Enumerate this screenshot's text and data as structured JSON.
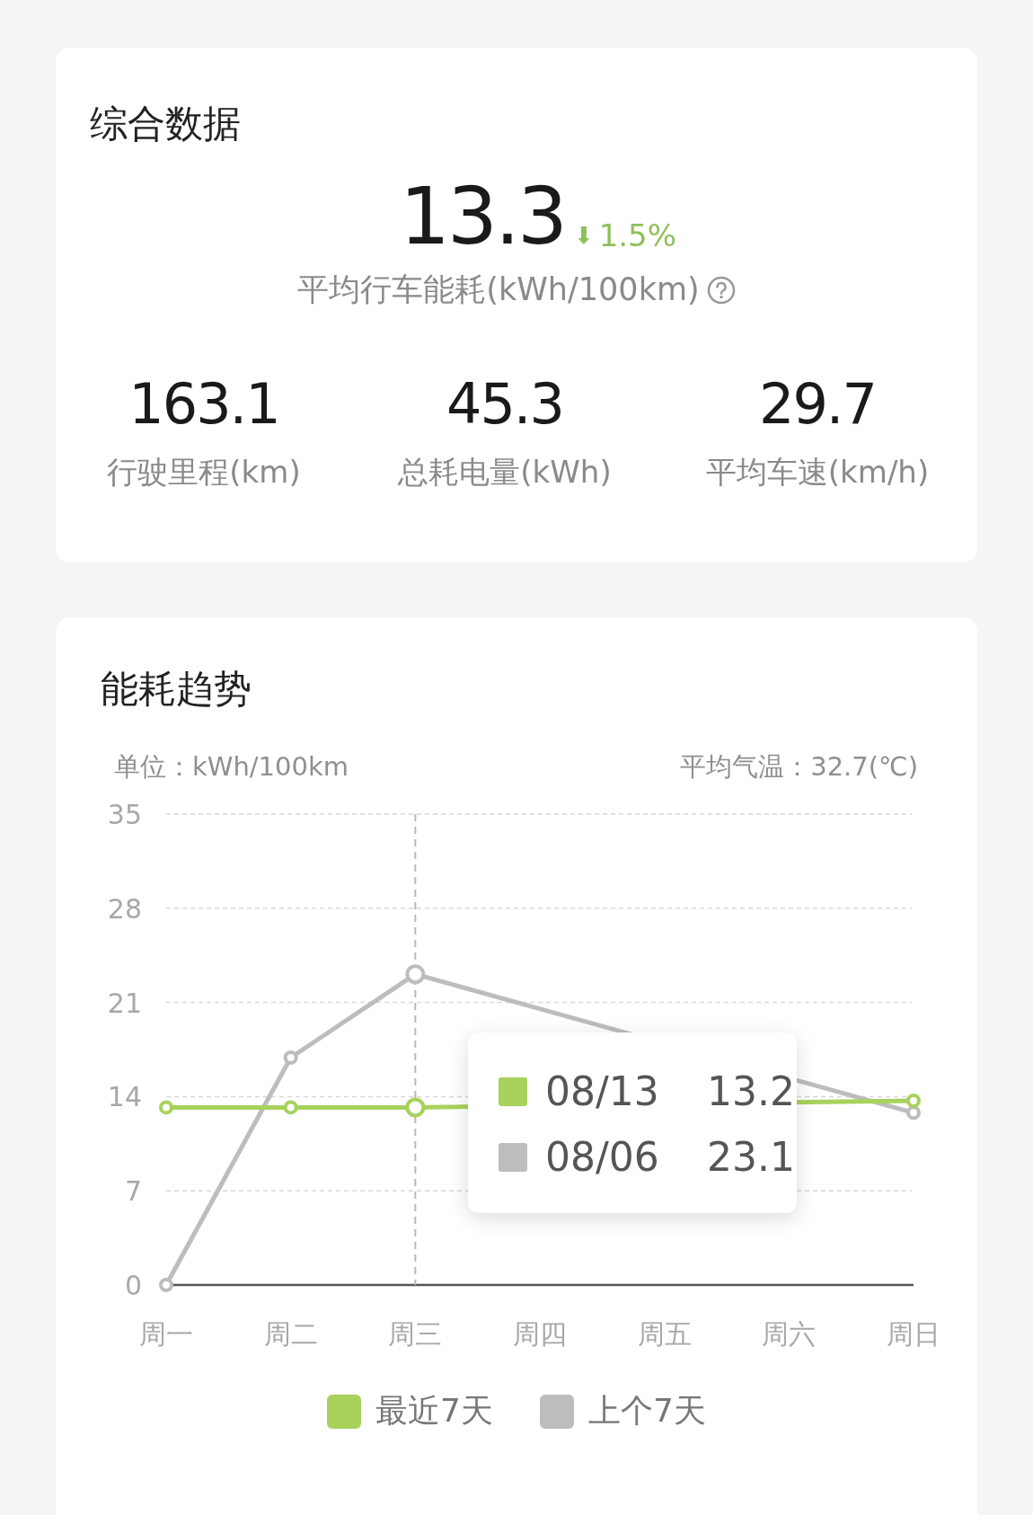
{
  "summary": {
    "title": "综合数据",
    "main": {
      "value": "13.3",
      "arrow": "⬇",
      "change": "1.5%",
      "label": "平均行车能耗(kWh/100km)"
    },
    "stats": [
      {
        "value": "163.1",
        "label": "行驶里程(km)"
      },
      {
        "value": "45.3",
        "label": "总耗电量(kWh)"
      },
      {
        "value": "29.7",
        "label": "平均车速(km/h)"
      }
    ]
  },
  "trend": {
    "title": "能耗趋势",
    "unit": "单位：kWh/100km",
    "temperature": "平均气温：32.7(℃)",
    "chart_data": {
      "type": "line",
      "categories": [
        "周一",
        "周二",
        "周三",
        "周四",
        "周五",
        "周六",
        "周日"
      ],
      "ylim": [
        0,
        35
      ],
      "yticks": [
        0,
        7,
        14,
        21,
        28,
        35
      ],
      "grid": true,
      "series": [
        {
          "name": "最近7天",
          "color": "#a8d25c",
          "marker": "circle",
          "values": [
            13.2,
            13.2,
            13.2,
            null,
            null,
            null,
            13.7
          ]
        },
        {
          "name": "上个7天",
          "color": "#bdbdbd",
          "marker": "circle",
          "values": [
            0,
            16.9,
            23.1,
            null,
            null,
            null,
            12.8
          ]
        }
      ],
      "ref_lines": [
        {
          "axis": "x",
          "value": "周三"
        }
      ]
    },
    "tooltip": [
      {
        "date": "08/13",
        "value": "13.2",
        "color": "#a8d25c"
      },
      {
        "date": "08/06",
        "value": "23.1",
        "color": "#bdbdbd"
      }
    ]
  }
}
